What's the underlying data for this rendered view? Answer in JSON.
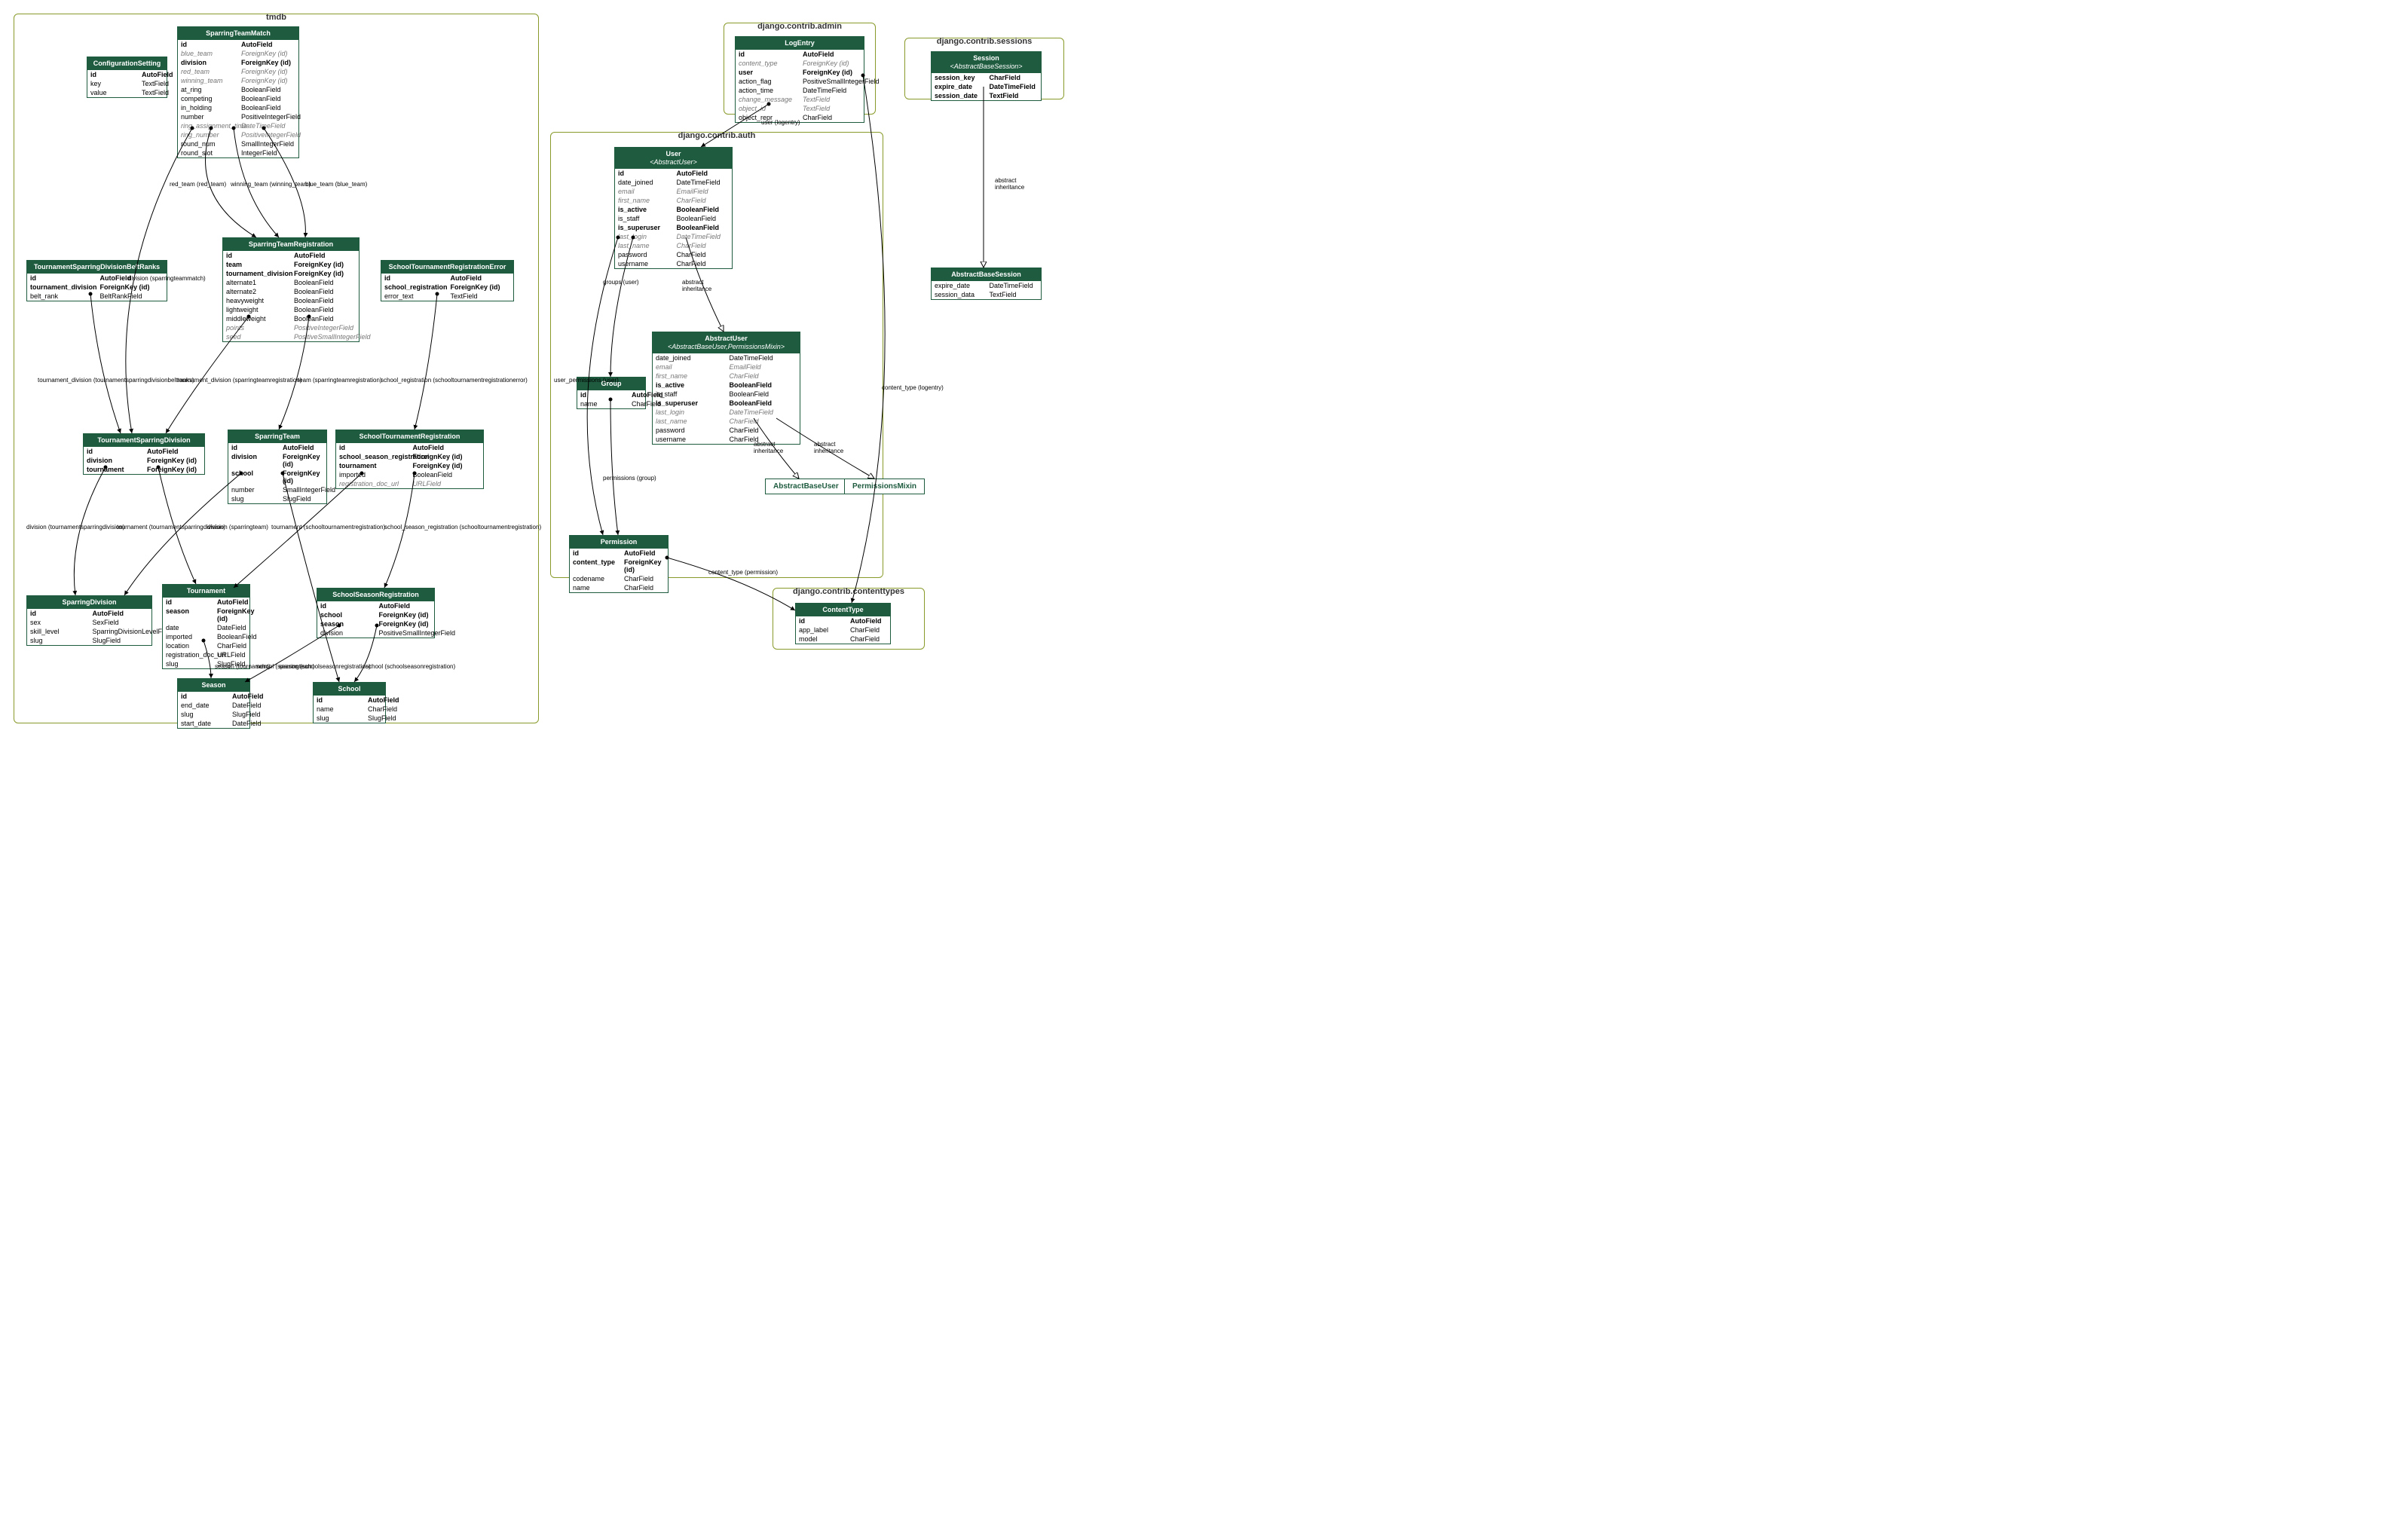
{
  "clusters": {
    "tmdb": {
      "label": "tmdb"
    },
    "admin": {
      "label": "django.contrib.admin"
    },
    "auth": {
      "label": "django.contrib.auth"
    },
    "sessions": {
      "label": "django.contrib.sessions"
    },
    "contenttypes": {
      "label": "django.contrib.contenttypes"
    }
  },
  "entities": {
    "ConfigurationSetting": {
      "title": "ConfigurationSetting",
      "rows": [
        {
          "a": "id",
          "b": "AutoField",
          "bold": true
        },
        {
          "a": "key",
          "b": "TextField"
        },
        {
          "a": "value",
          "b": "TextField"
        }
      ]
    },
    "SparringTeamMatch": {
      "title": "SparringTeamMatch",
      "rows": [
        {
          "a": "id",
          "b": "AutoField",
          "bold": true
        },
        {
          "a": "blue_team",
          "b": "ForeignKey (id)",
          "ital": true
        },
        {
          "a": "division",
          "b": "ForeignKey (id)",
          "bold": true
        },
        {
          "a": "red_team",
          "b": "ForeignKey (id)",
          "ital": true
        },
        {
          "a": "winning_team",
          "b": "ForeignKey (id)",
          "ital": true
        },
        {
          "a": "at_ring",
          "b": "BooleanField"
        },
        {
          "a": "competing",
          "b": "BooleanField"
        },
        {
          "a": "in_holding",
          "b": "BooleanField"
        },
        {
          "a": "number",
          "b": "PositiveIntegerField"
        },
        {
          "a": "ring_assignment_time",
          "b": "DateTimeField",
          "ital": true
        },
        {
          "a": "ring_number",
          "b": "PositiveIntegerField",
          "ital": true
        },
        {
          "a": "round_num",
          "b": "SmallIntegerField"
        },
        {
          "a": "round_slot",
          "b": "IntegerField"
        }
      ]
    },
    "TournamentSparringDivisionBeltRanks": {
      "title": "TournamentSparringDivisionBeltRanks",
      "rows": [
        {
          "a": "id",
          "b": "AutoField",
          "bold": true
        },
        {
          "a": "tournament_division",
          "b": "ForeignKey (id)",
          "bold": true
        },
        {
          "a": "belt_rank",
          "b": "BeltRankField"
        }
      ]
    },
    "SparringTeamRegistration": {
      "title": "SparringTeamRegistration",
      "rows": [
        {
          "a": "id",
          "b": "AutoField",
          "bold": true
        },
        {
          "a": "team",
          "b": "ForeignKey (id)",
          "bold": true
        },
        {
          "a": "tournament_division",
          "b": "ForeignKey (id)",
          "bold": true
        },
        {
          "a": "alternate1",
          "b": "BooleanField"
        },
        {
          "a": "alternate2",
          "b": "BooleanField"
        },
        {
          "a": "heavyweight",
          "b": "BooleanField"
        },
        {
          "a": "lightweight",
          "b": "BooleanField"
        },
        {
          "a": "middleweight",
          "b": "BooleanField"
        },
        {
          "a": "points",
          "b": "PositiveIntegerField",
          "ital": true
        },
        {
          "a": "seed",
          "b": "PositiveSmallIntegerField",
          "ital": true
        }
      ]
    },
    "SchoolTournamentRegistrationError": {
      "title": "SchoolTournamentRegistrationError",
      "rows": [
        {
          "a": "id",
          "b": "AutoField",
          "bold": true
        },
        {
          "a": "school_registration",
          "b": "ForeignKey (id)",
          "bold": true
        },
        {
          "a": "error_text",
          "b": "TextField"
        }
      ]
    },
    "TournamentSparringDivision": {
      "title": "TournamentSparringDivision",
      "rows": [
        {
          "a": "id",
          "b": "AutoField",
          "bold": true
        },
        {
          "a": "division",
          "b": "ForeignKey (id)",
          "bold": true
        },
        {
          "a": "tournament",
          "b": "ForeignKey (id)",
          "bold": true
        }
      ]
    },
    "SparringTeam": {
      "title": "SparringTeam",
      "rows": [
        {
          "a": "id",
          "b": "AutoField",
          "bold": true
        },
        {
          "a": "division",
          "b": "ForeignKey (id)",
          "bold": true
        },
        {
          "a": "school",
          "b": "ForeignKey (id)",
          "bold": true
        },
        {
          "a": "number",
          "b": "SmallIntegerField"
        },
        {
          "a": "slug",
          "b": "SlugField"
        }
      ]
    },
    "SchoolTournamentRegistration": {
      "title": "SchoolTournamentRegistration",
      "rows": [
        {
          "a": "id",
          "b": "AutoField",
          "bold": true
        },
        {
          "a": "school_season_registration",
          "b": "ForeignKey (id)",
          "bold": true
        },
        {
          "a": "tournament",
          "b": "ForeignKey (id)",
          "bold": true
        },
        {
          "a": "imported",
          "b": "BooleanField"
        },
        {
          "a": "registration_doc_url",
          "b": "URLField",
          "ital": true
        }
      ]
    },
    "SparringDivision": {
      "title": "SparringDivision",
      "rows": [
        {
          "a": "id",
          "b": "AutoField",
          "bold": true
        },
        {
          "a": "sex",
          "b": "SexField"
        },
        {
          "a": "skill_level",
          "b": "SparringDivisionLevelField"
        },
        {
          "a": "slug",
          "b": "SlugField"
        }
      ]
    },
    "Tournament": {
      "title": "Tournament",
      "rows": [
        {
          "a": "id",
          "b": "AutoField",
          "bold": true
        },
        {
          "a": "season",
          "b": "ForeignKey (id)",
          "bold": true
        },
        {
          "a": "date",
          "b": "DateField"
        },
        {
          "a": "imported",
          "b": "BooleanField"
        },
        {
          "a": "location",
          "b": "CharField"
        },
        {
          "a": "registration_doc_url",
          "b": "URLField"
        },
        {
          "a": "slug",
          "b": "SlugField"
        }
      ]
    },
    "SchoolSeasonRegistration": {
      "title": "SchoolSeasonRegistration",
      "rows": [
        {
          "a": "id",
          "b": "AutoField",
          "bold": true
        },
        {
          "a": "school",
          "b": "ForeignKey (id)",
          "bold": true
        },
        {
          "a": "season",
          "b": "ForeignKey (id)",
          "bold": true
        },
        {
          "a": "division",
          "b": "PositiveSmallIntegerField"
        }
      ]
    },
    "Season": {
      "title": "Season",
      "rows": [
        {
          "a": "id",
          "b": "AutoField",
          "bold": true
        },
        {
          "a": "end_date",
          "b": "DateField"
        },
        {
          "a": "slug",
          "b": "SlugField"
        },
        {
          "a": "start_date",
          "b": "DateField"
        }
      ]
    },
    "School": {
      "title": "School",
      "rows": [
        {
          "a": "id",
          "b": "AutoField",
          "bold": true
        },
        {
          "a": "name",
          "b": "CharField"
        },
        {
          "a": "slug",
          "b": "SlugField"
        }
      ]
    },
    "LogEntry": {
      "title": "LogEntry",
      "rows": [
        {
          "a": "id",
          "b": "AutoField",
          "bold": true
        },
        {
          "a": "content_type",
          "b": "ForeignKey (id)",
          "ital": true
        },
        {
          "a": "user",
          "b": "ForeignKey (id)",
          "bold": true
        },
        {
          "a": "action_flag",
          "b": "PositiveSmallIntegerField"
        },
        {
          "a": "action_time",
          "b": "DateTimeField"
        },
        {
          "a": "change_message",
          "b": "TextField",
          "ital": true
        },
        {
          "a": "object_id",
          "b": "TextField",
          "ital": true
        },
        {
          "a": "object_repr",
          "b": "CharField"
        }
      ]
    },
    "User": {
      "title": "User",
      "sub": "<AbstractUser>",
      "rows": [
        {
          "a": "id",
          "b": "AutoField",
          "bold": true
        },
        {
          "a": "date_joined",
          "b": "DateTimeField"
        },
        {
          "a": "email",
          "b": "EmailField",
          "ital": true
        },
        {
          "a": "first_name",
          "b": "CharField",
          "ital": true
        },
        {
          "a": "is_active",
          "b": "BooleanField",
          "bold": true
        },
        {
          "a": "is_staff",
          "b": "BooleanField"
        },
        {
          "a": "is_superuser",
          "b": "BooleanField",
          "bold": true
        },
        {
          "a": "last_login",
          "b": "DateTimeField",
          "ital": true
        },
        {
          "a": "last_name",
          "b": "CharField",
          "ital": true
        },
        {
          "a": "password",
          "b": "CharField"
        },
        {
          "a": "username",
          "b": "CharField"
        }
      ]
    },
    "AbstractUser": {
      "title": "AbstractUser",
      "sub": "<AbstractBaseUser,PermissionsMixin>",
      "rows": [
        {
          "a": "date_joined",
          "b": "DateTimeField"
        },
        {
          "a": "email",
          "b": "EmailField",
          "ital": true
        },
        {
          "a": "first_name",
          "b": "CharField",
          "ital": true
        },
        {
          "a": "is_active",
          "b": "BooleanField",
          "bold": true
        },
        {
          "a": "is_staff",
          "b": "BooleanField"
        },
        {
          "a": "is_superuser",
          "b": "BooleanField",
          "bold": true
        },
        {
          "a": "last_login",
          "b": "DateTimeField",
          "ital": true
        },
        {
          "a": "last_name",
          "b": "CharField",
          "ital": true
        },
        {
          "a": "password",
          "b": "CharField"
        },
        {
          "a": "username",
          "b": "CharField"
        }
      ]
    },
    "Group": {
      "title": "Group",
      "rows": [
        {
          "a": "id",
          "b": "AutoField",
          "bold": true
        },
        {
          "a": "name",
          "b": "CharField"
        }
      ]
    },
    "Permission": {
      "title": "Permission",
      "rows": [
        {
          "a": "id",
          "b": "AutoField",
          "bold": true
        },
        {
          "a": "content_type",
          "b": "ForeignKey (id)",
          "bold": true
        },
        {
          "a": "codename",
          "b": "CharField"
        },
        {
          "a": "name",
          "b": "CharField"
        }
      ]
    },
    "Session": {
      "title": "Session",
      "sub": "<AbstractBaseSession>",
      "rows": [
        {
          "a": "session_key",
          "b": "CharField",
          "bold": true
        },
        {
          "a": "expire_date",
          "b": "DateTimeField",
          "bold": true
        },
        {
          "a": "session_date",
          "b": "TextField",
          "bold": true
        }
      ]
    },
    "AbstractBaseSession": {
      "title": "AbstractBaseSession",
      "rows": [
        {
          "a": "expire_date",
          "b": "DateTimeField"
        },
        {
          "a": "session_data",
          "b": "TextField"
        }
      ]
    },
    "ContentType": {
      "title": "ContentType",
      "rows": [
        {
          "a": "id",
          "b": "AutoField",
          "bold": true
        },
        {
          "a": "app_label",
          "b": "CharField"
        },
        {
          "a": "model",
          "b": "CharField"
        }
      ]
    }
  },
  "simple_nodes": {
    "AbstractBaseUser": "AbstractBaseUser",
    "PermissionsMixin": "PermissionsMixin"
  },
  "edges": {
    "e1": "red_team (red_team)",
    "e2": "winning_team (winning_team)",
    "e3": "blue_team (blue_team)",
    "e4": "division (sparringteammatch)",
    "e5": "tournament_division (tournamentsparringdivisionbeltranks)",
    "e6": "tournament_division (sparringteamregistration)",
    "e7": "team (sparringteamregistration)",
    "e8": "school_registration (schooltournamentregistrationerror)",
    "e9": "division (tournamentsparringdivision)",
    "e10": "tournament (tournamentsparringdivision)",
    "e11": "division (sparringteam)",
    "e12": "tournament (schooltournamentregistration)",
    "e13": "school_season_registration (schooltournamentregistration)",
    "e14": "school (sparringteam)",
    "e15": "season (tournament)",
    "e16": "season (schoolseasonregistration)",
    "e17": "school (schoolseasonregistration)",
    "e18": "user (logentry)",
    "e19": "groups (user)",
    "e20": "abstract\ninheritance",
    "e21": "user_permissions (user)",
    "e22": "permissions (group)",
    "e23": "abstract\ninheritance",
    "e24": "abstract\ninheritance",
    "e25": "content_type (permission)",
    "e26": "content_type (logentry)",
    "e27": "abstract\ninheritance"
  }
}
